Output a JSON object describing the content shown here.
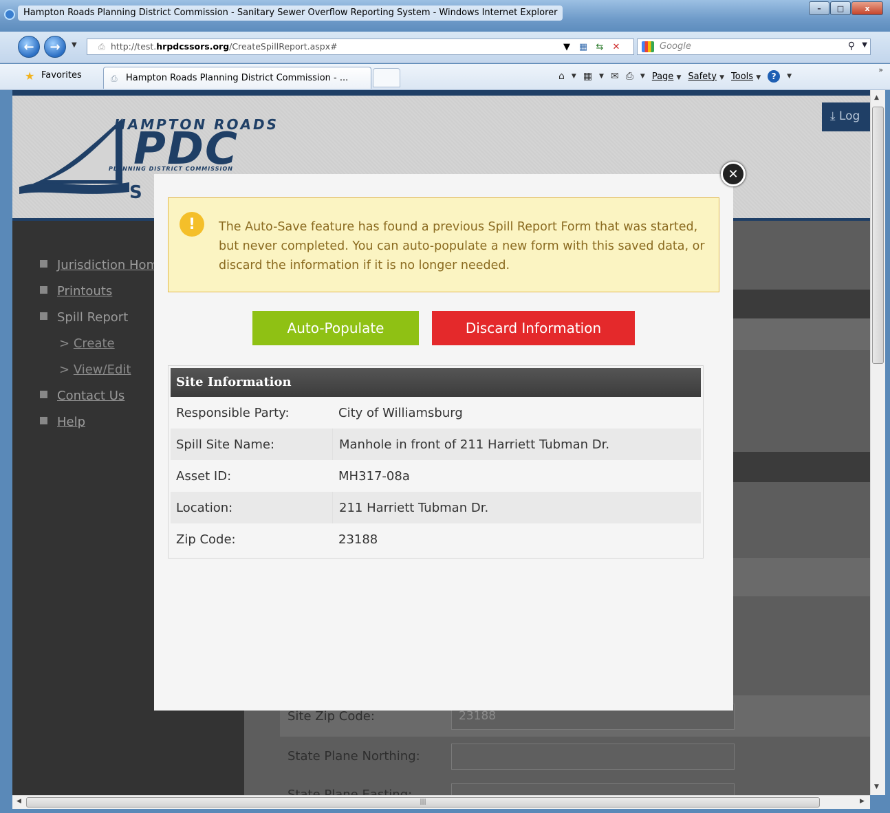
{
  "window": {
    "title": "Hampton Roads Planning District Commission - Sanitary Sewer Overflow Reporting System - Windows Internet Explorer",
    "minimize": "–",
    "maximize": "□",
    "close": "x"
  },
  "addressbar": {
    "url_prefix": "http://test.",
    "url_host": "hrpdcssors.org",
    "url_path": "/CreateSpillReport.aspx#",
    "search_placeholder": "Google"
  },
  "favorites": {
    "label": "Favorites",
    "tab_title": "Hampton Roads Planning District Commission - ..."
  },
  "commandbar": {
    "page": "Page",
    "safety": "Safety",
    "tools": "Tools"
  },
  "site": {
    "logo_top": "HAMPTON ROADS",
    "logo_main": "PDC",
    "logo_sub": "PLANNING DISTRICT COMMISSION",
    "logo_ss": "S S",
    "login_label": "Log"
  },
  "nav": {
    "items": [
      {
        "label": "Jurisdiction Home",
        "link": true
      },
      {
        "label": "Printouts",
        "link": true
      },
      {
        "label": "Spill Report",
        "link": false
      },
      {
        "label": "Create",
        "link": true
      },
      {
        "label": "View/Edit",
        "link": true
      },
      {
        "label": "Contact Us",
        "link": true
      },
      {
        "label": "Help",
        "link": true
      }
    ]
  },
  "background_form": {
    "zip_label": "Site Zip Code:",
    "zip_value": "23188",
    "northing_label": "State Plane Northing:",
    "easting_label": "State Plane Easting:"
  },
  "modal": {
    "alert_text": "The Auto-Save feature has found a previous Spill Report Form that was started, but never completed. You can auto-populate a new form with this saved data, or discard the information if it is no longer needed.",
    "autopopulate_label": "Auto-Populate",
    "discard_label": "Discard Information",
    "site_info": {
      "header": "Site Information",
      "rows": [
        {
          "label": "Responsible Party:",
          "value": "City of Williamsburg"
        },
        {
          "label": "Spill Site Name:",
          "value": "Manhole in front of 211 Harriett Tubman Dr."
        },
        {
          "label": "Asset ID:",
          "value": "MH317-08a"
        },
        {
          "label": "Location:",
          "value": "211 Harriett Tubman Dr."
        },
        {
          "label": "Zip Code:",
          "value": "23188"
        }
      ]
    }
  },
  "colors": {
    "accent_green": "#8fc114",
    "accent_red": "#e4292b",
    "alert_bg": "#fbf4c2",
    "brand_navy": "#1f3f66"
  },
  "icons": [
    "ie-logo-icon",
    "back-icon",
    "forward-icon",
    "refresh-icon",
    "stop-icon",
    "search-icon",
    "favorites-star-icon",
    "home-icon",
    "rss-icon",
    "mail-icon",
    "print-icon",
    "help-icon",
    "close-modal-icon",
    "warning-icon",
    "login-icon"
  ]
}
